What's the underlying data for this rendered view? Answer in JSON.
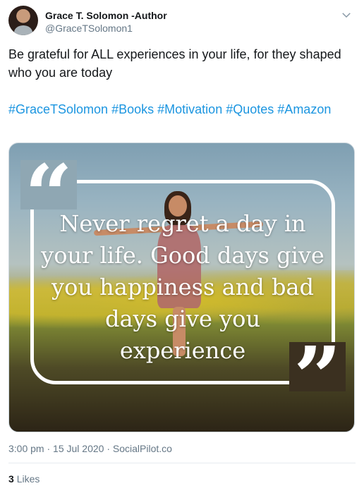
{
  "author": {
    "display_name": "Grace T. Solomon -Author",
    "handle": "@GraceTSolomon1"
  },
  "tweet": {
    "text": "Be grateful for ALL experiences in your life, for they shaped who you are today",
    "hashtags": [
      "#GraceTSolomon",
      "#Books",
      "#Motivation",
      "#Quotes",
      "#Amazon"
    ]
  },
  "media": {
    "quote_open": "“",
    "quote_close": "”",
    "quote_text": "Never regret a day in your life. Good days give you happiness and bad days give you experience"
  },
  "meta": {
    "time": "3:00 pm",
    "date": "15 Jul 2020",
    "source": "SocialPilot.co",
    "separator": "·"
  },
  "engagement": {
    "likes_count": "3",
    "likes_label": "Likes"
  },
  "icons": {
    "caret": "chevron-down-icon"
  },
  "colors": {
    "link": "#1b95e0",
    "secondary_text": "#657786"
  }
}
